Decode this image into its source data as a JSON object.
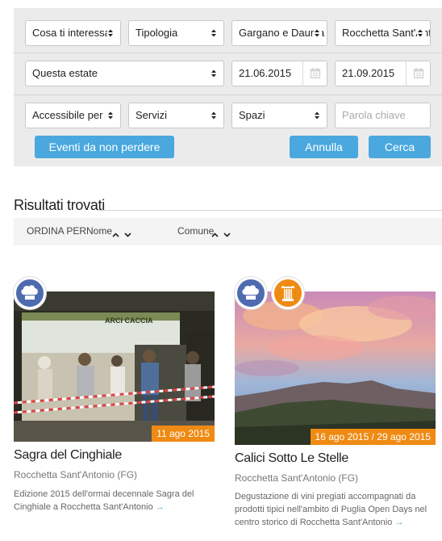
{
  "filters": {
    "row1": [
      {
        "label": "Cosa ti interessa",
        "name": "interest-select"
      },
      {
        "label": "Tipologia",
        "name": "type-select"
      },
      {
        "label": "Gargano e Daunia",
        "name": "area-select"
      },
      {
        "label": "Rocchetta Sant'Antonio",
        "name": "town-select"
      }
    ],
    "period": "Questa estate",
    "date_from": "21.06.2015",
    "date_to": "21.09.2015",
    "row3": [
      {
        "label": "Accessibile per",
        "name": "accessibility-select"
      },
      {
        "label": "Servizi",
        "name": "services-select"
      },
      {
        "label": "Spazi",
        "name": "spaces-select"
      }
    ],
    "keyword_placeholder": "Parola chiave"
  },
  "buttons": {
    "highlights": "Eventi da non perdere",
    "cancel": "Annulla",
    "search": "Cerca"
  },
  "results": {
    "title": "Risultati trovati",
    "sort_label": "ORDINA PER",
    "sort_name": "Nome",
    "sort_town": "Comune"
  },
  "cards": [
    {
      "title": "Sagra del Cinghiale",
      "location": "Rocchetta Sant'Antonio (FG)",
      "date": "11 ago 2015",
      "description": "Edizione 2015 dell'ormai decennale Sagra del Cinghiale a Rocchetta Sant'Antonio",
      "more": "→",
      "icons": [
        "chef-hat-icon"
      ],
      "banner_text": "ARCI CACCIA"
    },
    {
      "title": "Calici Sotto Le Stelle",
      "location": "Rocchetta Sant'Antonio (FG)",
      "date": "16 ago 2015 / 29 ago 2015",
      "description": "Degustazione di vini pregiati accompagnati da prodotti tipici nell'ambito di Puglia Open Days nel centro storico di Rocchetta Sant'Antonio",
      "more": "→",
      "icons": [
        "chef-hat-icon",
        "column-icon"
      ]
    }
  ],
  "colors": {
    "accent": "#4aa8df",
    "badge": "#ef8a13",
    "icon_food": "#4f6bb0",
    "icon_culture": "#ef8a13"
  }
}
